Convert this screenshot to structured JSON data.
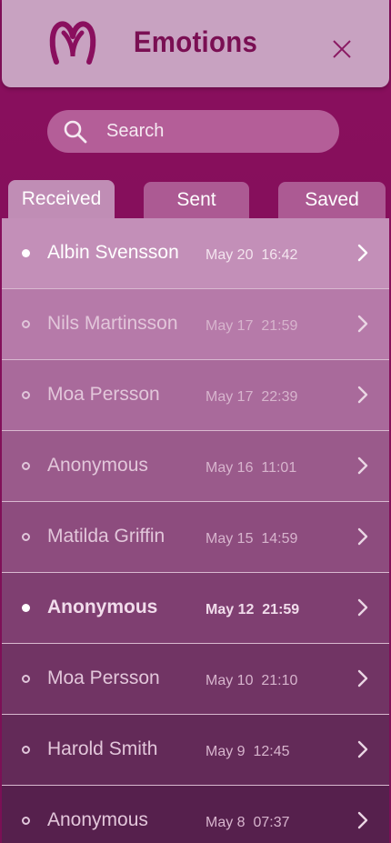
{
  "header": {
    "title": "Emotions",
    "logo_icon": "heart-m-logo-icon",
    "close_icon": "close-icon",
    "brand_color": "#7a0f53"
  },
  "search": {
    "placeholder": "Search",
    "icon": "search-icon"
  },
  "tabs": [
    {
      "label": "Received",
      "active": true
    },
    {
      "label": "Sent",
      "active": false
    },
    {
      "label": "Saved",
      "active": false
    }
  ],
  "messages": [
    {
      "name": "Albin Svensson",
      "date": "May 20",
      "time": "16:42",
      "unread": true,
      "bold": false
    },
    {
      "name": "Nils Martinsson",
      "date": "May 17",
      "time": "21:59",
      "unread": false,
      "bold": false
    },
    {
      "name": "Moa Persson",
      "date": "May 17",
      "time": "22:39",
      "unread": false,
      "bold": false
    },
    {
      "name": "Anonymous",
      "date": "May 16",
      "time": "11:01",
      "unread": false,
      "bold": false
    },
    {
      "name": "Matilda Griffin",
      "date": "May 15",
      "time": "14:59",
      "unread": false,
      "bold": false
    },
    {
      "name": "Anonymous",
      "date": "May 12",
      "time": "21:59",
      "unread": true,
      "bold": true
    },
    {
      "name": "Moa Persson",
      "date": "May 10",
      "time": "21:10",
      "unread": false,
      "bold": false
    },
    {
      "name": "Harold Smith",
      "date": "May 9",
      "time": "12:45",
      "unread": false,
      "bold": false
    },
    {
      "name": "Anonymous",
      "date": "May 8",
      "time": "07:37",
      "unread": false,
      "bold": false
    }
  ],
  "colors": {
    "background": "#8a0f5e",
    "header_bg": "#c8a2c1",
    "active_tab": "#c08db5",
    "inactive_tab": "#ac5a93"
  }
}
